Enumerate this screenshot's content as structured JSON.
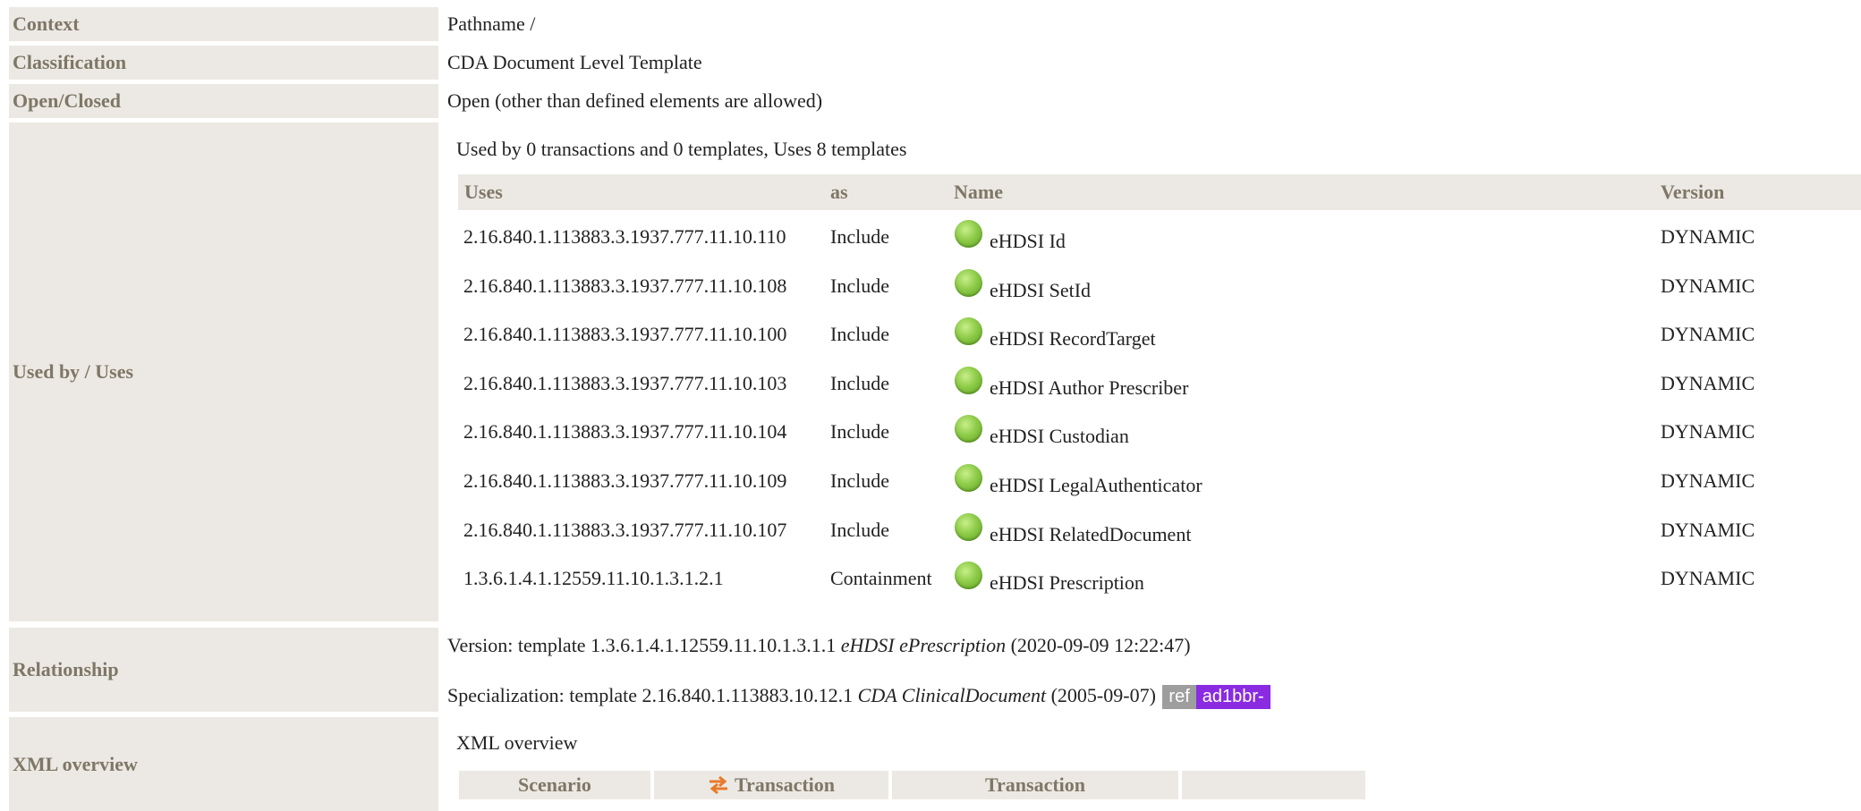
{
  "context": {
    "label": "Context",
    "value": "Pathname /"
  },
  "classification": {
    "label": "Classification",
    "value": "CDA Document Level Template"
  },
  "open_closed": {
    "label": "Open/Closed",
    "value": "Open (other than defined elements are allowed)"
  },
  "used_by": {
    "label": "Used by / Uses",
    "summary": "Used by 0 transactions and 0 templates, Uses 8 templates",
    "headers": {
      "uses": "Uses",
      "as": "as",
      "name": "Name",
      "version": "Version"
    },
    "rows": [
      {
        "uses": "2.16.840.1.113883.3.1937.777.11.10.110",
        "as": "Include",
        "name": "eHDSI Id",
        "version": "DYNAMIC"
      },
      {
        "uses": "2.16.840.1.113883.3.1937.777.11.10.108",
        "as": "Include",
        "name": "eHDSI SetId",
        "version": "DYNAMIC"
      },
      {
        "uses": "2.16.840.1.113883.3.1937.777.11.10.100",
        "as": "Include",
        "name": "eHDSI RecordTarget",
        "version": "DYNAMIC"
      },
      {
        "uses": "2.16.840.1.113883.3.1937.777.11.10.103",
        "as": "Include",
        "name": "eHDSI Author Prescriber",
        "version": "DYNAMIC"
      },
      {
        "uses": "2.16.840.1.113883.3.1937.777.11.10.104",
        "as": "Include",
        "name": "eHDSI Custodian",
        "version": "DYNAMIC"
      },
      {
        "uses": "2.16.840.1.113883.3.1937.777.11.10.109",
        "as": "Include",
        "name": "eHDSI LegalAuthenticator",
        "version": "DYNAMIC"
      },
      {
        "uses": "2.16.840.1.113883.3.1937.777.11.10.107",
        "as": "Include",
        "name": "eHDSI RelatedDocument",
        "version": "DYNAMIC"
      },
      {
        "uses": "1.3.6.1.4.1.12559.11.10.1.3.1.2.1",
        "as": "Containment",
        "name": "eHDSI Prescription",
        "version": "DYNAMIC"
      }
    ],
    "status_icon": "green-status-dot-icon",
    "status_color": "#8dcb48"
  },
  "relationship": {
    "label": "Relationship",
    "version_prefix": "Version: template 1.3.6.1.4.1.12559.11.10.1.3.1.1",
    "version_name": "eHDSI ePrescription",
    "version_date": "(2020-09-09 12:22:47)",
    "spec_prefix": "Specialization: template 2.16.840.1.113883.10.12.1",
    "spec_name": "CDA ClinicalDocument",
    "spec_date": "(2005-09-07)",
    "badge_ref": "ref",
    "badge_id": "ad1bbr-",
    "badge_ref_color": "#9e9e9e",
    "badge_id_color": "#8a2be2"
  },
  "xml_overview": {
    "label": "XML overview",
    "title": "XML overview",
    "headers": {
      "scenario": "Scenario",
      "transaction": "Transaction",
      "transaction2": "Transaction",
      "empty": ""
    },
    "swap_icon": "swap-arrows-icon",
    "swap_color": "#e8792a"
  }
}
